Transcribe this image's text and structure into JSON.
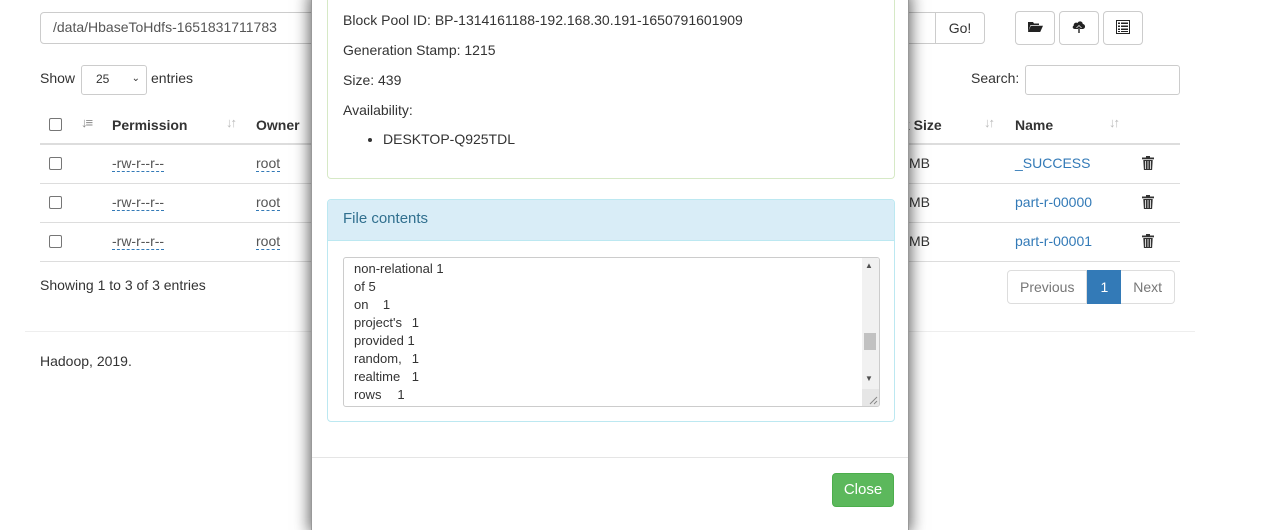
{
  "toolbar": {
    "path_value": "/data/HbaseToHdfs-1651831711783",
    "go_label": "Go!",
    "buttons": [
      {
        "icon": "folder-open-icon"
      },
      {
        "icon": "cloud-upload-icon"
      },
      {
        "icon": "list-icon"
      }
    ]
  },
  "table_controls": {
    "show_label": "Show",
    "entries_value": "25",
    "entries_label": "entries",
    "search_label": "Search:",
    "search_value": ""
  },
  "table": {
    "headers": [
      "Permission",
      "Owner",
      "k Size",
      "Name"
    ],
    "rows": [
      {
        "permission": "-rw-r--r--",
        "owner": "root",
        "block_size": "MB",
        "name": "_SUCCESS"
      },
      {
        "permission": "-rw-r--r--",
        "owner": "root",
        "block_size": "MB",
        "name": "part-r-00000"
      },
      {
        "permission": "-rw-r--r--",
        "owner": "root",
        "block_size": "MB",
        "name": "part-r-00001"
      }
    ],
    "info": "Showing 1 to 3 of 3 entries",
    "pagination": {
      "previous": "Previous",
      "current": "1",
      "next": "Next"
    }
  },
  "footer": {
    "text": "Hadoop, 2019."
  },
  "modal": {
    "block_info": {
      "block_pool_id": "Block Pool ID: BP-1314161188-192.168.30.191-1650791601909",
      "generation_stamp": "Generation Stamp: 1215",
      "size": "Size: 439",
      "availability_label": "Availability:",
      "availability": [
        "DESKTOP-Q925TDL"
      ]
    },
    "file_contents": {
      "heading": "File contents",
      "lines": [
        "non-relational 1",
        "of\t5",
        "on\t1",
        "project's\t1",
        "provided 1",
        "random,\t1",
        "realtime\t1",
        "rows\t1"
      ]
    },
    "close_label": "Close"
  },
  "colors": {
    "link": "#337ab7",
    "success": "#5cb85c",
    "info_bg": "#d9edf7",
    "info_text": "#31708f"
  }
}
